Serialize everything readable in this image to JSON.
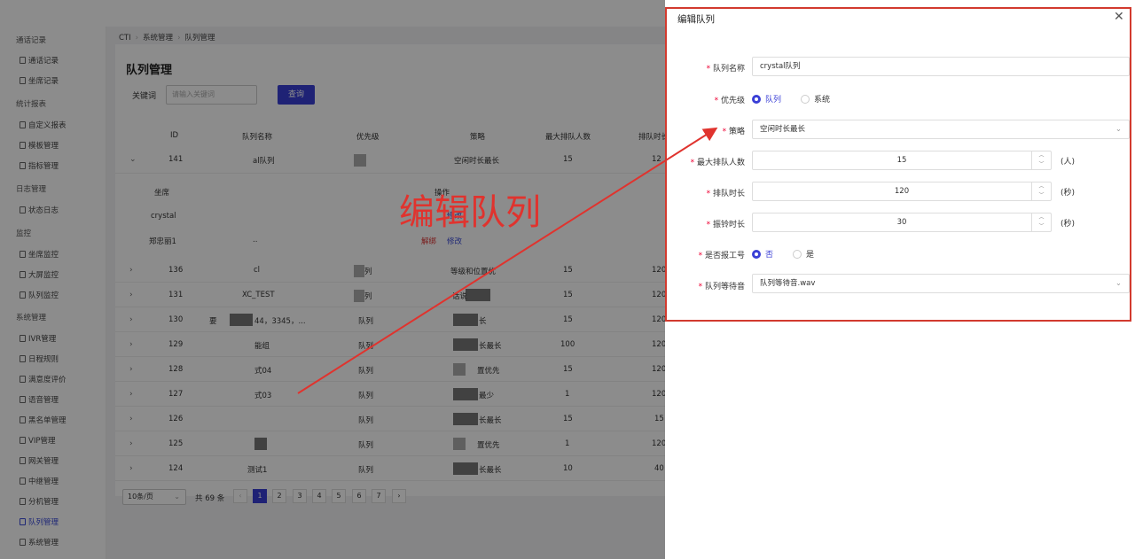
{
  "breadcrumb": [
    "CTI",
    "系统管理",
    "队列管理"
  ],
  "sidebar": {
    "groups": [
      {
        "label": "通话记录",
        "items": [
          "通话记录",
          "坐席记录"
        ]
      },
      {
        "label": "统计报表",
        "items": [
          "自定义报表",
          "模板管理",
          "指标管理"
        ]
      },
      {
        "label": "日志管理",
        "items": [
          "状态日志"
        ]
      },
      {
        "label": "监控",
        "items": [
          "坐席监控",
          "大屏监控",
          "队列监控"
        ]
      },
      {
        "label": "系统管理",
        "items": [
          "IVR管理",
          "日程规则",
          "满意度评价",
          "语音管理",
          "黑名单管理",
          "VIP管理",
          "网关管理",
          "中继管理",
          "分机管理",
          "队列管理",
          "系统管理"
        ]
      }
    ],
    "active": "队列管理"
  },
  "page": {
    "title": "队列管理",
    "keyword_label": "关键词",
    "keyword_placeholder": "请输入关键词",
    "query_label": "查询"
  },
  "table": {
    "headers": [
      "ID",
      "队列名称",
      "优先级",
      "策略",
      "最大排队人数",
      "排队时长"
    ],
    "header_cut": "排队时长",
    "expanded": {
      "id": "141",
      "name": "al队列",
      "strategy": "空闲时长最长",
      "max": "15",
      "wait": "12"
    },
    "sub": {
      "col_header": "坐席",
      "op_header": "操作",
      "agents": [
        "crystal",
        "郑忠丽1"
      ],
      "ops": [
        "解绑",
        "修改"
      ],
      "dots": "..",
      "op_top": "修改"
    },
    "rows": [
      {
        "id": "136",
        "name": "cl",
        "priority": "列",
        "strategy": "等级和位置优",
        "max": "15",
        "wait": "120"
      },
      {
        "id": "131",
        "name": "XC_TEST",
        "priority": "列",
        "strategy": "话说",
        "max": "15",
        "wait": "120"
      },
      {
        "id": "130",
        "name": "44，3345，...",
        "priority": "队列",
        "strategy": "长",
        "max": "15",
        "wait": "120",
        "prefix": "要"
      },
      {
        "id": "129",
        "name": "能组",
        "priority": "队列",
        "strategy": "长最长",
        "max": "100",
        "wait": "120"
      },
      {
        "id": "128",
        "name": "式04",
        "priority": "队列",
        "strategy": "置优先",
        "max": "15",
        "wait": "120"
      },
      {
        "id": "127",
        "name": "式03",
        "priority": "队列",
        "strategy": "最少",
        "max": "1",
        "wait": "120"
      },
      {
        "id": "126",
        "name": "",
        "priority": "队列",
        "strategy": "长最长",
        "max": "15",
        "wait": "15"
      },
      {
        "id": "125",
        "name": "",
        "priority": "队列",
        "strategy": "置优先",
        "max": "1",
        "wait": "120"
      },
      {
        "id": "124",
        "name": "测试1",
        "priority": "队列",
        "strategy": "长最长",
        "max": "10",
        "wait": "40"
      }
    ]
  },
  "pagination": {
    "size": "10条/页",
    "total": "共 69 条",
    "pages": [
      "1",
      "2",
      "3",
      "4",
      "5",
      "6",
      "7"
    ],
    "prev": "‹",
    "next": "›"
  },
  "annotation": "编辑队列",
  "drawer": {
    "title": "编辑队列",
    "close": "✕",
    "fields": {
      "name_label": "队列名称",
      "name_value": "crystal队列",
      "priority_label": "优先级",
      "priority_options": [
        "队列",
        "系统"
      ],
      "strategy_label": "策略",
      "strategy_value": "空闲时长最长",
      "max_label": "最大排队人数",
      "max_value": "15",
      "max_unit": "(人)",
      "wait_label": "排队时长",
      "wait_value": "120",
      "wait_unit": "(秒)",
      "ring_label": "振铃时长",
      "ring_value": "30",
      "ring_unit": "(秒)",
      "report_label": "是否报工号",
      "report_options": [
        "否",
        "是"
      ],
      "music_label": "队列等待音",
      "music_value": "队列等待音.wav"
    },
    "asterisk": "*"
  },
  "colors": {
    "accent": "#3a3fd6",
    "annotation": "#e0332e"
  }
}
